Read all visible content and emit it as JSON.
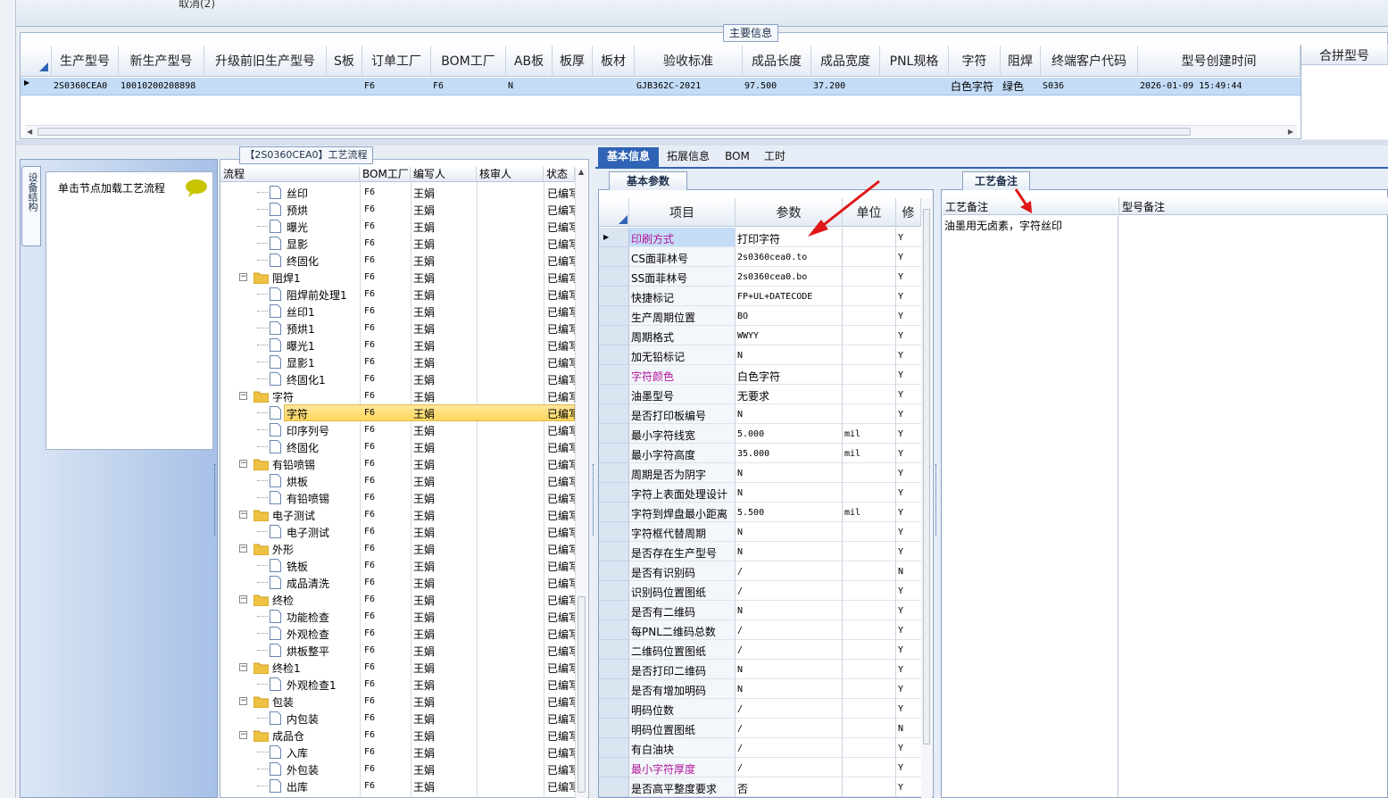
{
  "top": {
    "cancel_label": "取消(2)"
  },
  "main_info": {
    "title": "主要信息",
    "columns": [
      "生产型号",
      "新生产型号",
      "升级前旧生产型号",
      "S板",
      "订单工厂",
      "BOM工厂",
      "AB板",
      "板厚",
      "板材",
      "验收标准",
      "成品长度",
      "成品宽度",
      "PNL规格",
      "字符",
      "阻焊",
      "终端客户代码",
      "型号创建时间"
    ],
    "row": [
      "2S0360CEA0",
      "10010200208898",
      "",
      "",
      "F6",
      "F6",
      "N",
      "",
      "",
      "GJB362C-2021",
      "97.500",
      "37.200",
      "",
      "白色字符",
      "绿色",
      "S036",
      "2026-01-09 15:49:44"
    ],
    "merge_header": "合拼型号"
  },
  "left_panel": {
    "vertical_tab": "设备结构",
    "hint": "单击节点加载工艺流程"
  },
  "flow": {
    "title": "【2S0360CEA0】工艺流程",
    "columns": [
      "流程",
      "BOM工厂",
      "编写人",
      "核审人",
      "状态"
    ],
    "rows": [
      {
        "name": "丝印",
        "folder": false,
        "f": "F6",
        "w": "王娟",
        "s": "已编写"
      },
      {
        "name": "预烘",
        "folder": false,
        "f": "F6",
        "w": "王娟",
        "s": "已编写"
      },
      {
        "name": "曝光",
        "folder": false,
        "f": "F6",
        "w": "王娟",
        "s": "已编写"
      },
      {
        "name": "显影",
        "folder": false,
        "f": "F6",
        "w": "王娟",
        "s": "已编写"
      },
      {
        "name": "终固化",
        "folder": false,
        "f": "F6",
        "w": "王娟",
        "s": "已编写"
      },
      {
        "name": "阻焊1",
        "folder": true,
        "f": "F6",
        "w": "王娟",
        "s": "已编写"
      },
      {
        "name": "阻焊前处理1",
        "folder": false,
        "f": "F6",
        "w": "王娟",
        "s": "已编写"
      },
      {
        "name": "丝印1",
        "folder": false,
        "f": "F6",
        "w": "王娟",
        "s": "已编写"
      },
      {
        "name": "预烘1",
        "folder": false,
        "f": "F6",
        "w": "王娟",
        "s": "已编写"
      },
      {
        "name": "曝光1",
        "folder": false,
        "f": "F6",
        "w": "王娟",
        "s": "已编写"
      },
      {
        "name": "显影1",
        "folder": false,
        "f": "F6",
        "w": "王娟",
        "s": "已编写"
      },
      {
        "name": "终固化1",
        "folder": false,
        "f": "F6",
        "w": "王娟",
        "s": "已编写"
      },
      {
        "name": "字符",
        "folder": true,
        "f": "F6",
        "w": "王娟",
        "s": "已编写"
      },
      {
        "name": "字符",
        "folder": false,
        "f": "F6",
        "w": "王娟",
        "s": "已编写",
        "sel": true
      },
      {
        "name": "印序列号",
        "folder": false,
        "f": "F6",
        "w": "王娟",
        "s": "已编写"
      },
      {
        "name": "终固化",
        "folder": false,
        "f": "F6",
        "w": "王娟",
        "s": "已编写"
      },
      {
        "name": "有铅喷锡",
        "folder": true,
        "f": "F6",
        "w": "王娟",
        "s": "已编写"
      },
      {
        "name": "烘板",
        "folder": false,
        "f": "F6",
        "w": "王娟",
        "s": "已编写"
      },
      {
        "name": "有铅喷锡",
        "folder": false,
        "f": "F6",
        "w": "王娟",
        "s": "已编写"
      },
      {
        "name": "电子测试",
        "folder": true,
        "f": "F6",
        "w": "王娟",
        "s": "已编写"
      },
      {
        "name": "电子测试",
        "folder": false,
        "f": "F6",
        "w": "王娟",
        "s": "已编写"
      },
      {
        "name": "外形",
        "folder": true,
        "f": "F6",
        "w": "王娟",
        "s": "已编写"
      },
      {
        "name": "铣板",
        "folder": false,
        "f": "F6",
        "w": "王娟",
        "s": "已编写"
      },
      {
        "name": "成品清洗",
        "folder": false,
        "f": "F6",
        "w": "王娟",
        "s": "已编写"
      },
      {
        "name": "终检",
        "folder": true,
        "f": "F6",
        "w": "王娟",
        "s": "已编写"
      },
      {
        "name": "功能检查",
        "folder": false,
        "f": "F6",
        "w": "王娟",
        "s": "已编写"
      },
      {
        "name": "外观检查",
        "folder": false,
        "f": "F6",
        "w": "王娟",
        "s": "已编写"
      },
      {
        "name": "烘板整平",
        "folder": false,
        "f": "F6",
        "w": "王娟",
        "s": "已编写"
      },
      {
        "name": "终检1",
        "folder": true,
        "f": "F6",
        "w": "王娟",
        "s": "已编写"
      },
      {
        "name": "外观检查1",
        "folder": false,
        "f": "F6",
        "w": "王娟",
        "s": "已编写"
      },
      {
        "name": "包装",
        "folder": true,
        "f": "F6",
        "w": "王娟",
        "s": "已编写"
      },
      {
        "name": "内包装",
        "folder": false,
        "f": "F6",
        "w": "王娟",
        "s": "已编写"
      },
      {
        "name": "成品仓",
        "folder": true,
        "f": "F6",
        "w": "王娟",
        "s": "已编写"
      },
      {
        "name": "入库",
        "folder": false,
        "f": "F6",
        "w": "王娟",
        "s": "已编写"
      },
      {
        "name": "外包装",
        "folder": false,
        "f": "F6",
        "w": "王娟",
        "s": "已编写"
      },
      {
        "name": "出库",
        "folder": false,
        "f": "F6",
        "w": "王娟",
        "s": "已编写"
      }
    ]
  },
  "tabs": [
    "基本信息",
    "拓展信息",
    "BOM",
    "工时"
  ],
  "params": {
    "section": "基本参数",
    "columns": [
      "项目",
      "参数",
      "单位",
      "修"
    ],
    "rows": [
      {
        "k": "印刷方式",
        "v": "打印字符",
        "u": "",
        "m": "Y",
        "hl": true
      },
      {
        "k": "CS面菲林号",
        "v": "2s0360cea0.to",
        "u": "",
        "m": "Y"
      },
      {
        "k": "SS面菲林号",
        "v": "2s0360cea0.bo",
        "u": "",
        "m": "Y"
      },
      {
        "k": "快捷标记",
        "v": "FP+UL+DATECODE",
        "u": "",
        "m": "Y"
      },
      {
        "k": "生产周期位置",
        "v": "BO",
        "u": "",
        "m": "Y"
      },
      {
        "k": "周期格式",
        "v": "WWYY",
        "u": "",
        "m": "Y"
      },
      {
        "k": "加无铅标记",
        "v": "N",
        "u": "",
        "m": "Y"
      },
      {
        "k": "字符颜色",
        "v": "白色字符",
        "u": "",
        "m": "Y",
        "hl": true
      },
      {
        "k": "油墨型号",
        "v": "无要求",
        "u": "",
        "m": "Y"
      },
      {
        "k": "是否打印板编号",
        "v": "N",
        "u": "",
        "m": "Y"
      },
      {
        "k": "最小字符线宽",
        "v": "5.000",
        "u": "mil",
        "m": "Y"
      },
      {
        "k": "最小字符高度",
        "v": "35.000",
        "u": "mil",
        "m": "Y"
      },
      {
        "k": "周期是否为阴字",
        "v": "N",
        "u": "",
        "m": "Y"
      },
      {
        "k": "字符上表面处理设计",
        "v": "N",
        "u": "",
        "m": "Y"
      },
      {
        "k": "字符到焊盘最小距离",
        "v": "5.500",
        "u": "mil",
        "m": "Y"
      },
      {
        "k": "字符框代替周期",
        "v": "N",
        "u": "",
        "m": "Y"
      },
      {
        "k": "是否存在生产型号",
        "v": "N",
        "u": "",
        "m": "Y"
      },
      {
        "k": "是否有识别码",
        "v": "/",
        "u": "",
        "m": "N"
      },
      {
        "k": "识别码位置图纸",
        "v": "/",
        "u": "",
        "m": "Y"
      },
      {
        "k": "是否有二维码",
        "v": "N",
        "u": "",
        "m": "Y"
      },
      {
        "k": "每PNL二维码总数",
        "v": "/",
        "u": "",
        "m": "Y"
      },
      {
        "k": "二维码位置图纸",
        "v": "/",
        "u": "",
        "m": "Y"
      },
      {
        "k": "是否打印二维码",
        "v": "N",
        "u": "",
        "m": "Y"
      },
      {
        "k": "是否有增加明码",
        "v": "N",
        "u": "",
        "m": "Y"
      },
      {
        "k": "明码位数",
        "v": "/",
        "u": "",
        "m": "Y"
      },
      {
        "k": "明码位置图纸",
        "v": "/",
        "u": "",
        "m": "N"
      },
      {
        "k": "有白油块",
        "v": "/",
        "u": "",
        "m": "Y"
      },
      {
        "k": "最小字符厚度",
        "v": "/",
        "u": "",
        "m": "Y",
        "hl": true
      },
      {
        "k": "是否高平整度要求",
        "v": "否",
        "u": "",
        "m": "Y"
      }
    ]
  },
  "notes": {
    "tab": "工艺备注",
    "col1": "工艺备注",
    "col2": "型号备注",
    "text": "油墨用无卤素，字符丝印"
  },
  "colors": {
    "accent": "#2f63b5",
    "highlight_text": "#b0169a",
    "selection": "#c4dcf6",
    "row_selected": "#ffd75e",
    "arrow": "#e01818"
  }
}
